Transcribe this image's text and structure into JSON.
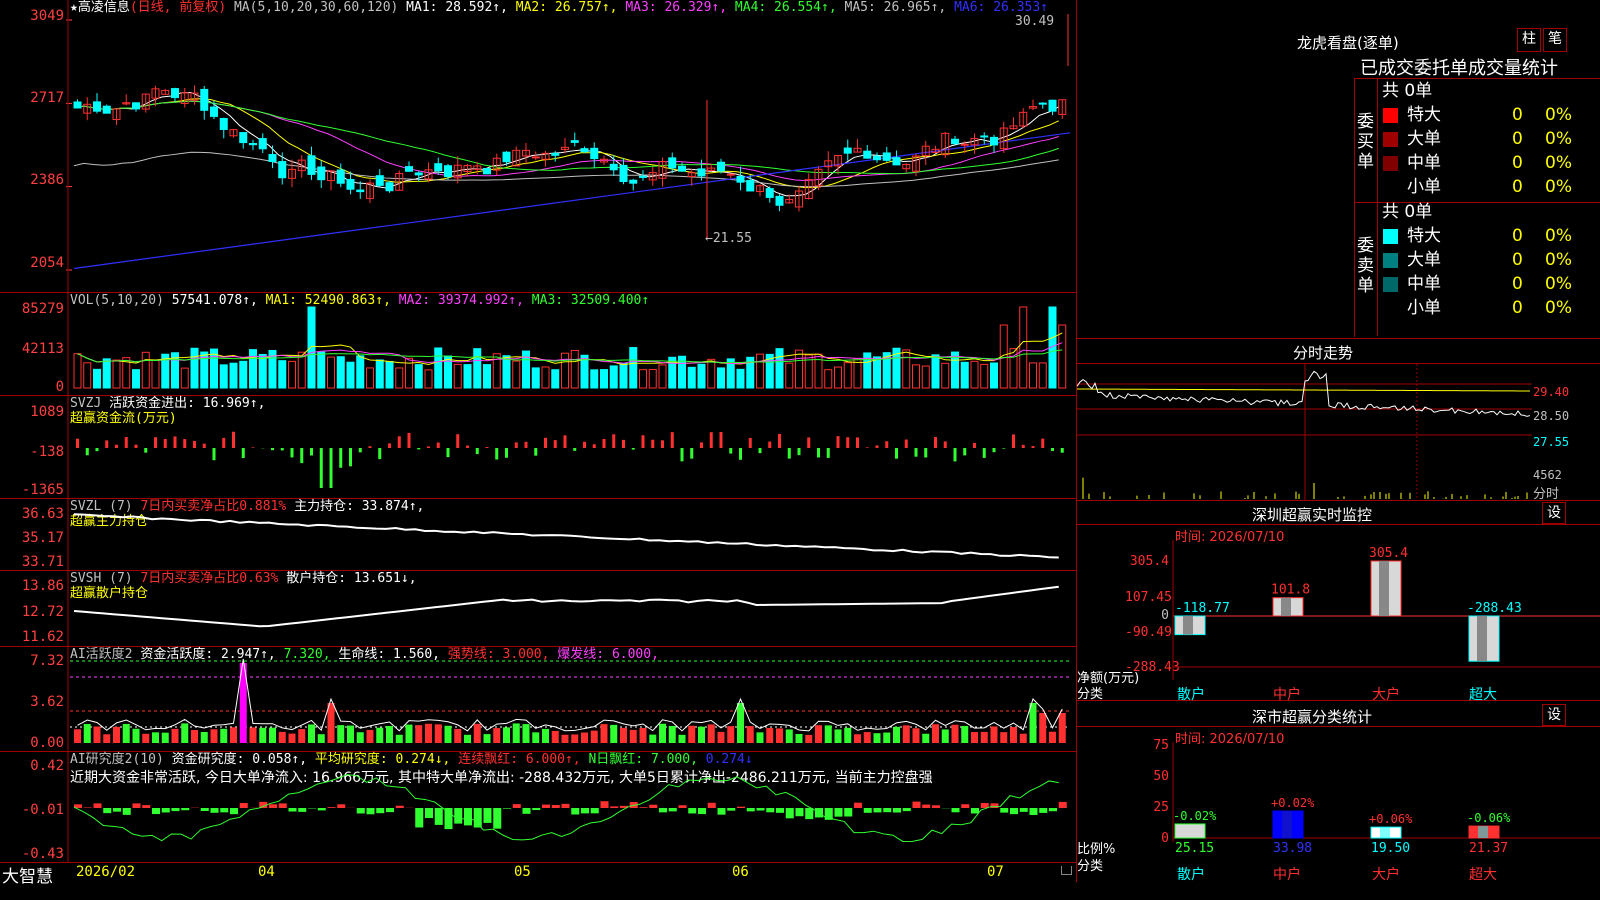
{
  "stock": {
    "star": "★",
    "name": "高凌信息",
    "mode": "(日线, 前复权)"
  },
  "main": {
    "ma_hdr": [
      {
        "t": "MA(5,10,20,30,60,120)",
        "c": "#c0c0c0"
      },
      {
        "t": "MA1: 28.592↑,",
        "c": "#ffffff"
      },
      {
        "t": "MA2: 26.757↑,",
        "c": "#ffff00"
      },
      {
        "t": "MA3: 26.329↑,",
        "c": "#ff40ff"
      },
      {
        "t": "MA4: 26.554↑,",
        "c": "#30ff30"
      },
      {
        "t": "MA5: 26.965↑,",
        "c": "#c0c0c0"
      },
      {
        "t": "MA6: 26.353↑",
        "c": "#3030ff"
      }
    ],
    "y_labels": [
      "3049",
      "2717",
      "2386",
      "2054"
    ],
    "high_note": "30.49",
    "low_note": "←21.55"
  },
  "vol": {
    "hdr": [
      {
        "t": "VOL(5,10,20)",
        "c": "#c0c0c0"
      },
      {
        "t": "57541.078↑,",
        "c": "#ffffff"
      },
      {
        "t": "MA1: 52490.863↑,",
        "c": "#ffff00"
      },
      {
        "t": "MA2: 39374.992↑,",
        "c": "#ff40ff"
      },
      {
        "t": "MA3: 32509.400↑",
        "c": "#30ff30"
      }
    ],
    "y_labels": [
      "85279",
      "42113",
      "0"
    ]
  },
  "svzj": {
    "hdr": [
      {
        "t": "SVZJ",
        "c": "#c0c0c0"
      },
      {
        "t": "活跃资金进出: 16.969↑,",
        "c": "#ffffff"
      }
    ],
    "sub": "超赢资金流(万元)",
    "y_labels": [
      "1089",
      "-138",
      "-1365"
    ]
  },
  "svzl": {
    "hdr": [
      {
        "t": "SVZL (7)",
        "c": "#c0c0c0"
      },
      {
        "t": "7日内买卖净占比0.881%",
        "c": "#ff3030"
      },
      {
        "t": "主力持仓: 33.874↑,",
        "c": "#ffffff"
      }
    ],
    "sub": "超赢主力持仓",
    "y_labels": [
      "36.63",
      "35.17",
      "33.71"
    ]
  },
  "svsh": {
    "hdr": [
      {
        "t": "SVSH (7)",
        "c": "#c0c0c0"
      },
      {
        "t": "7日内买卖净占比0.63%",
        "c": "#ff3030"
      },
      {
        "t": "散户持仓: 13.651↓,",
        "c": "#ffffff"
      }
    ],
    "sub": "超赢散户持仓",
    "y_labels": [
      "13.86",
      "12.72",
      "11.62"
    ]
  },
  "ai1": {
    "hdr": [
      {
        "t": "AI活跃度2",
        "c": "#c0c0c0"
      },
      {
        "t": "资金活跃度: 2.947↑,",
        "c": "#ffffff"
      },
      {
        "t": "7.320,",
        "c": "#30ff30"
      },
      {
        "t": "生命线: 1.560,",
        "c": "#ffffff"
      },
      {
        "t": "强势线: 3.000,",
        "c": "#ff3030"
      },
      {
        "t": "爆发线: 6.000,",
        "c": "#ff40ff"
      }
    ],
    "y_labels": [
      "7.32",
      "3.62",
      "0.00"
    ]
  },
  "ai2": {
    "hdr": [
      {
        "t": "AI研究度2(10)",
        "c": "#c0c0c0"
      },
      {
        "t": "资金研究度: 0.058↑,",
        "c": "#ffffff"
      },
      {
        "t": "平均研究度: 0.274↓,",
        "c": "#ffff00"
      },
      {
        "t": "连续飘红: 6.000↑,",
        "c": "#ff3030"
      },
      {
        "t": "N日飘红: 7.000,",
        "c": "#30ff30"
      },
      {
        "t": "0.274↓",
        "c": "#3030ff"
      }
    ],
    "note": "近期大资金非常活跃, 今日大单净流入: 16.966万元, 其中特大单净流出: -288.432万元, 大单5日累计净出-2486.211万元, 当前主力控盘强",
    "y_labels": [
      "0.42",
      "-0.01",
      "-0.43"
    ]
  },
  "footer": {
    "app": "大智慧",
    "dates": [
      "2026/02",
      "04",
      "05",
      "06",
      "07"
    ]
  },
  "right": {
    "lhkp_title": "龙虎看盘(逐单)",
    "btn_zhu": "柱",
    "btn_bi": "笔",
    "stats_title": "已成交委托单成交量统计",
    "buy_label": "委买单",
    "sell_label": "委卖单",
    "buy_total": "共 0单",
    "sell_total": "共 0单",
    "buy_rows": [
      {
        "name": "特大",
        "val": "0",
        "pct": "0%",
        "color": "#ff0000"
      },
      {
        "name": "大单",
        "val": "0",
        "pct": "0%",
        "color": "#a00000"
      },
      {
        "name": "中单",
        "val": "0",
        "pct": "0%",
        "color": "#800000"
      },
      {
        "name": "小单",
        "val": "0",
        "pct": "0%",
        "color": ""
      }
    ],
    "sell_rows": [
      {
        "name": "特大",
        "val": "0",
        "pct": "0%",
        "color": "#00ffff"
      },
      {
        "name": "大单",
        "val": "0",
        "pct": "0%",
        "color": "#008080"
      },
      {
        "name": "中单",
        "val": "0",
        "pct": "0%",
        "color": "#006868"
      },
      {
        "name": "小单",
        "val": "0",
        "pct": "0%",
        "color": ""
      }
    ],
    "fs_title": "分时走势",
    "fs_labels": [
      "29.40",
      "28.50",
      "27.55",
      "4562"
    ],
    "fs_unit": "分时",
    "sz_title": "深圳超赢实时监控",
    "sz_btn": "设",
    "sz_time": "时间: 2026/07/10",
    "sz_y": [
      "305.4",
      "107.45",
      "0",
      "-90.49",
      "-288.43"
    ],
    "sz_axis_label1": "净额(万元)",
    "sz_axis_label2": "分类",
    "sz_cats": [
      "散户",
      "中户",
      "大户",
      "超大"
    ],
    "ss_title": "深市超赢分类统计",
    "ss_btn": "设",
    "ss_time": "时间: 2026/07/10",
    "ss_y": [
      "75",
      "50",
      "25",
      "0"
    ],
    "ss_axis_label1": "比例%",
    "ss_axis_label2": "分类",
    "ss_cats": [
      "散户",
      "中户",
      "大户",
      "超大"
    ]
  },
  "chart_data": [
    {
      "type": "bar",
      "title": "深圳超赢实时监控",
      "categories": [
        "散户",
        "中户",
        "大户",
        "超大"
      ],
      "values": [
        -118.77,
        101.8,
        305.4,
        -288.43
      ],
      "ylim": [
        -288.43,
        305.4
      ]
    },
    {
      "type": "bar",
      "title": "深市超赢分类统计",
      "categories": [
        "散户",
        "中户",
        "大户",
        "超大"
      ],
      "values": [
        25.15,
        33.98,
        19.5,
        21.37
      ],
      "changes": [
        "-0.02%",
        "+0.02%",
        "+0.06%",
        "-0.06%"
      ],
      "ylim": [
        0,
        75
      ]
    }
  ]
}
